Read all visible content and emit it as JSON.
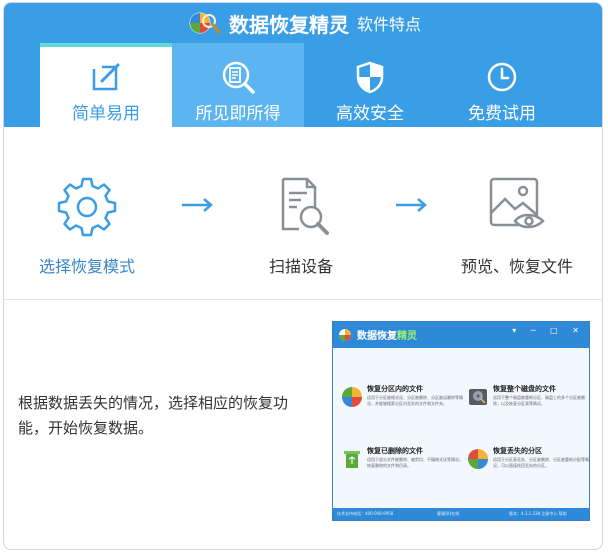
{
  "header": {
    "title": "数据恢复精灵",
    "subtitle": "软件特点"
  },
  "tabs": [
    {
      "label": "简单易用",
      "icon": "edit-icon",
      "active": true
    },
    {
      "label": "所见即所得",
      "icon": "document-search-icon",
      "active": false
    },
    {
      "label": "高效安全",
      "icon": "shield-icon",
      "active": false
    },
    {
      "label": "免费试用",
      "icon": "clock-icon",
      "active": false
    }
  ],
  "steps": [
    {
      "label": "选择恢复模式",
      "icon": "gear-icon"
    },
    {
      "label": "扫描设备",
      "icon": "scan-document-icon"
    },
    {
      "label": "预览、恢复文件",
      "icon": "image-preview-icon"
    }
  ],
  "description": "根据数据丢失的情况，选择相应的恢复功能，开始恢复数据。",
  "screenshot": {
    "title_prefix": "数据恢复",
    "title_highlight": "精灵",
    "window_controls": "▾ ─ □ ✕",
    "options": [
      {
        "title": "恢复分区内的文件",
        "desc": "适用于分区被格式化、分区被删除、分区被误删除等情况，并能够搜索分区内丢失的文件和文件夹。"
      },
      {
        "title": "恢复整个磁盘的文件",
        "desc": "适用于整个磁盘被重新分区、磁盘上的多个分区被删除，以及恢复分区表等情况。"
      },
      {
        "title": "恢复已删除的文件",
        "desc": "适用于部分文件被删除、被剪切、不慎格式化等情况，恢复删除的文件和目录。"
      },
      {
        "title": "恢复丢失的分区",
        "desc": "适用于分区表丢失、分区被删除、分区被重新分配等情况，可以直接找回丢失的分区。"
      }
    ],
    "footer_left": "技术支持电话：400-008-9958",
    "footer_mid": "客服QQ在线",
    "footer_right": "版本：4.3.1.238  注册中心  帮助"
  },
  "colors": {
    "primary": "#3a9ee6",
    "accent_strip": "#5ddbd4",
    "tab_hover": "#5cb5f0",
    "icon_blue": "#3a9ee6",
    "icon_gray": "#8a8f96"
  }
}
